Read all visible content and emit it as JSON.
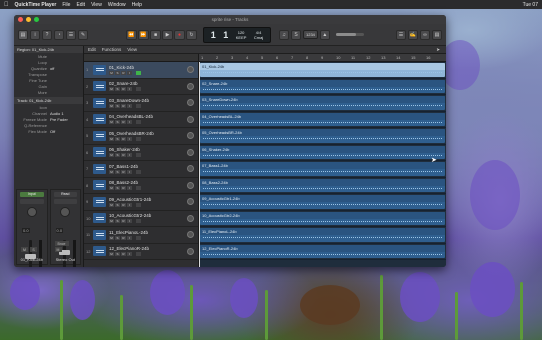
{
  "menubar": {
    "app_name": "QuickTime Player",
    "items": [
      "File",
      "Edit",
      "View",
      "Window",
      "Help"
    ],
    "clock": "Tue 07"
  },
  "window": {
    "title": "sprite rise - Tracks"
  },
  "lcd": {
    "bar": "1",
    "beat": "1",
    "tempo": "120",
    "tempo_label": "KEEP",
    "signature": "4/4",
    "key": "Cmaj"
  },
  "toolbar": {
    "count_in": "1234"
  },
  "editbar": {
    "edit": "Edit",
    "functions": "Functions",
    "view": "View"
  },
  "inspector": {
    "region_header": "Region: 01_Kick-24b",
    "region_rows": [
      {
        "k": "Mute",
        "v": ""
      },
      {
        "k": "Loop",
        "v": ""
      },
      {
        "k": "Quantize",
        "v": "off"
      },
      {
        "k": "Transpose",
        "v": ""
      },
      {
        "k": "Fine Tune",
        "v": ""
      },
      {
        "k": "Gain",
        "v": ""
      },
      {
        "k": "More",
        "v": ""
      }
    ],
    "track_header": "Track: 01_Kick-24b",
    "track_rows": [
      {
        "k": "Icon",
        "v": ""
      },
      {
        "k": "Channel",
        "v": "Audio 1"
      },
      {
        "k": "Freeze Mode",
        "v": "Pre Fader"
      },
      {
        "k": "Q-Reference",
        "v": ""
      },
      {
        "k": "Flex Mode",
        "v": "Off"
      }
    ],
    "strip_left": {
      "top": "Input",
      "vol": "0.0",
      "name": "01_Kick-24b"
    },
    "strip_right": {
      "top": "Read",
      "vol": "0.0",
      "name": "Stereo Out",
      "bnce": "Bnce"
    }
  },
  "ruler": [
    "1",
    "2",
    "3",
    "4",
    "5",
    "6",
    "7",
    "8",
    "9",
    "10",
    "11",
    "12",
    "13",
    "14",
    "15",
    "16"
  ],
  "tracks": [
    {
      "num": "1",
      "name": "01_Kick-24b",
      "selected": true
    },
    {
      "num": "2",
      "name": "02_Snare-24b",
      "selected": false
    },
    {
      "num": "3",
      "name": "03_SnareDown-24b",
      "selected": false
    },
    {
      "num": "4",
      "name": "04_OverheadsBL-24b",
      "selected": false
    },
    {
      "num": "5",
      "name": "05_OverheadsBR-24b",
      "selected": false
    },
    {
      "num": "6",
      "name": "06_Shaker-24b",
      "selected": false
    },
    {
      "num": "7",
      "name": "07_Bass1-24b",
      "selected": false
    },
    {
      "num": "8",
      "name": "08_Bass2-24b",
      "selected": false
    },
    {
      "num": "9",
      "name": "09_AcousticGtr1-24b",
      "selected": false
    },
    {
      "num": "10",
      "name": "10_AcousticGtr2-24b",
      "selected": false
    },
    {
      "num": "11",
      "name": "11_ElecPianoL-24b",
      "selected": false
    },
    {
      "num": "12",
      "name": "12_ElecPianoR-24b",
      "selected": false
    }
  ],
  "colors": {
    "region": "#2f5f8f",
    "region_selected": "#8fb6d8",
    "record": "#e33"
  }
}
